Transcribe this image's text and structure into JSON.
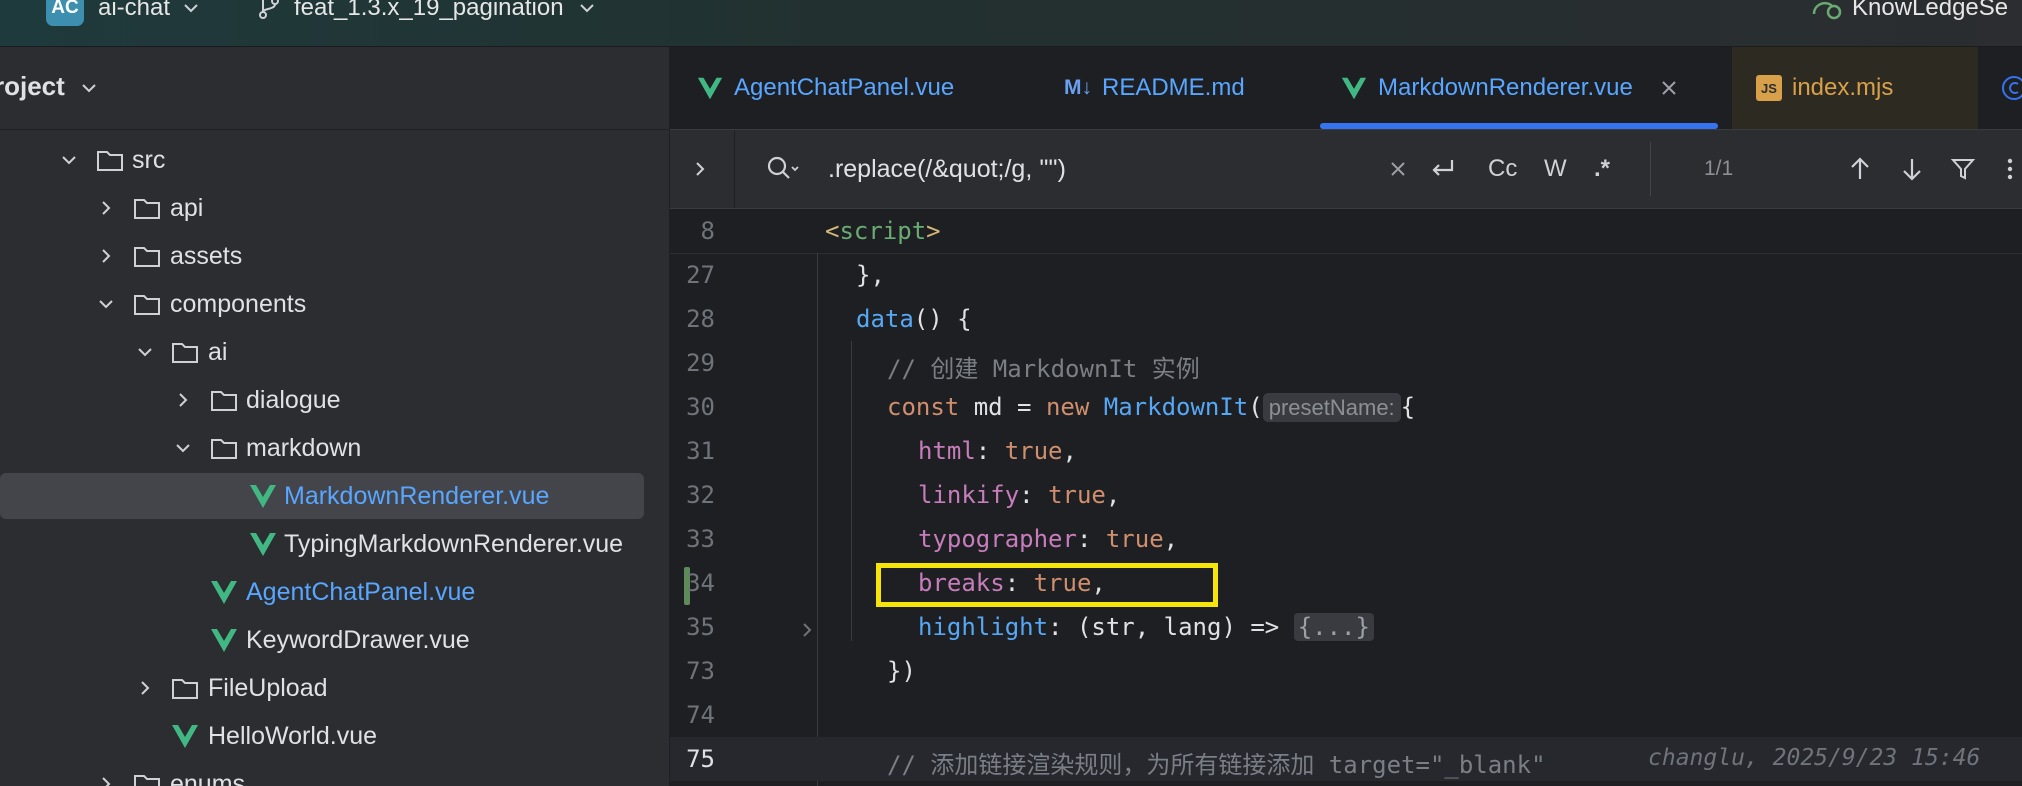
{
  "titlebar": {
    "project_badge": "AC",
    "project_name": "ai-chat",
    "branch_name": "feat_1.3.x_19_pagination",
    "right_label": "KnowLedgeSe"
  },
  "project_panel": {
    "title": "roject",
    "tree": [
      {
        "label": "src",
        "type": "folder",
        "expanded": true
      },
      {
        "label": "api",
        "type": "folder",
        "expanded": false
      },
      {
        "label": "assets",
        "type": "folder",
        "expanded": false
      },
      {
        "label": "components",
        "type": "folder",
        "expanded": true
      },
      {
        "label": "ai",
        "type": "folder",
        "expanded": true
      },
      {
        "label": "dialogue",
        "type": "folder",
        "expanded": false
      },
      {
        "label": "markdown",
        "type": "folder",
        "expanded": true
      },
      {
        "label": "MarkdownRenderer.vue",
        "type": "vue",
        "selected": true
      },
      {
        "label": "TypingMarkdownRenderer.vue",
        "type": "vue"
      },
      {
        "label": "AgentChatPanel.vue",
        "type": "vue",
        "modified": true
      },
      {
        "label": "KeywordDrawer.vue",
        "type": "vue"
      },
      {
        "label": "FileUpload",
        "type": "folder",
        "expanded": false
      },
      {
        "label": "HelloWorld.vue",
        "type": "vue"
      },
      {
        "label": "enums",
        "type": "folder",
        "expanded": false
      }
    ]
  },
  "tabs": [
    {
      "label": "AgentChatPanel.vue",
      "icon": "vue-icon"
    },
    {
      "label": "README.md",
      "icon": "markdown-icon",
      "icon_text": "M↓"
    },
    {
      "label": "MarkdownRenderer.vue",
      "icon": "vue-icon",
      "active": true
    },
    {
      "label": "index.mjs",
      "icon": "js-icon",
      "icon_text": "JS"
    }
  ],
  "search": {
    "query": ".replace(/&quot;/g, '\"')",
    "match_case": "Cc",
    "words": "W",
    "regex": ".*",
    "count": "1/1"
  },
  "code": {
    "sticky_line": {
      "num": "8",
      "open": "<",
      "name": "script",
      "close": ">"
    },
    "lines": [
      {
        "num": "27",
        "text": "},"
      },
      {
        "num": "28",
        "fn": "data",
        "rest": "() {"
      },
      {
        "num": "29",
        "comment": "// 创建 MarkdownIt 实例"
      },
      {
        "num": "30",
        "kw1": "const",
        "mid1": " md = ",
        "kw2": "new",
        "sp": " ",
        "fn": "MarkdownIt",
        "paren": "(",
        "hint": "presetName:",
        "brace": "{"
      },
      {
        "num": "31",
        "prop": "html",
        "colon": ": ",
        "val": "true",
        "end": ","
      },
      {
        "num": "32",
        "prop": "linkify",
        "colon": ": ",
        "val": "true",
        "end": ","
      },
      {
        "num": "33",
        "prop": "typographer",
        "colon": ": ",
        "val": "true",
        "end": ","
      },
      {
        "num": "34",
        "prop": "breaks",
        "colon": ": ",
        "val": "true",
        "end": ","
      },
      {
        "num": "35",
        "prop": "highlight",
        "rest": ": (str, lang) => ",
        "fold": "{...}"
      },
      {
        "num": "73",
        "text": "})"
      },
      {
        "num": "74",
        "text": ""
      },
      {
        "num": "75",
        "comment": "// 添加链接渲染规则，为所有链接添加 target=\"_blank\"",
        "blame": "changlu, 2025/9/23 15:46"
      }
    ]
  },
  "colors": {
    "accent": "#3574f0",
    "highlight_box": "#f5e50a",
    "vue_green": "#41b883",
    "modified_blue": "#58a6ff"
  }
}
